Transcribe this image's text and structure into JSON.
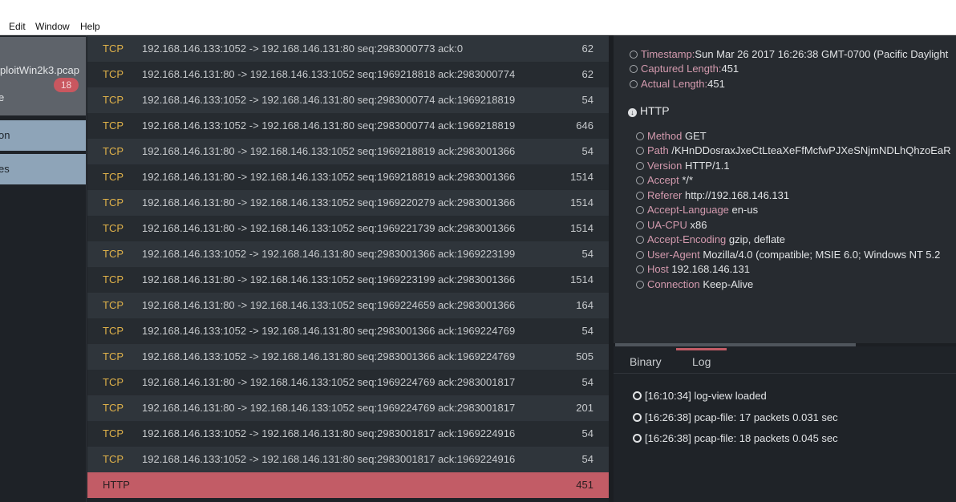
{
  "menu": {
    "items": [
      "Edit",
      "Window",
      "Help"
    ]
  },
  "sidebar": {
    "file_name": "ploitWin2k3.pcap",
    "file_sub": "e",
    "badge": "18",
    "buttons": [
      "on",
      "es"
    ]
  },
  "packets": [
    {
      "proto": "TCP",
      "summary": "192.168.146.133:1052 -> 192.168.146.131:80 seq:2983000773 ack:0",
      "length": "62"
    },
    {
      "proto": "TCP",
      "summary": "192.168.146.131:80 -> 192.168.146.133:1052 seq:1969218818 ack:2983000774",
      "length": "62"
    },
    {
      "proto": "TCP",
      "summary": "192.168.146.133:1052 -> 192.168.146.131:80 seq:2983000774 ack:1969218819",
      "length": "54"
    },
    {
      "proto": "TCP",
      "summary": "192.168.146.133:1052 -> 192.168.146.131:80 seq:2983000774 ack:1969218819",
      "length": "646"
    },
    {
      "proto": "TCP",
      "summary": "192.168.146.131:80 -> 192.168.146.133:1052 seq:1969218819 ack:2983001366",
      "length": "54"
    },
    {
      "proto": "TCP",
      "summary": "192.168.146.131:80 -> 192.168.146.133:1052 seq:1969218819 ack:2983001366",
      "length": "1514"
    },
    {
      "proto": "TCP",
      "summary": "192.168.146.131:80 -> 192.168.146.133:1052 seq:1969220279 ack:2983001366",
      "length": "1514"
    },
    {
      "proto": "TCP",
      "summary": "192.168.146.131:80 -> 192.168.146.133:1052 seq:1969221739 ack:2983001366",
      "length": "1514"
    },
    {
      "proto": "TCP",
      "summary": "192.168.146.133:1052 -> 192.168.146.131:80 seq:2983001366 ack:1969223199",
      "length": "54"
    },
    {
      "proto": "TCP",
      "summary": "192.168.146.131:80 -> 192.168.146.133:1052 seq:1969223199 ack:2983001366",
      "length": "1514"
    },
    {
      "proto": "TCP",
      "summary": "192.168.146.131:80 -> 192.168.146.133:1052 seq:1969224659 ack:2983001366",
      "length": "164"
    },
    {
      "proto": "TCP",
      "summary": "192.168.146.133:1052 -> 192.168.146.131:80 seq:2983001366 ack:1969224769",
      "length": "54"
    },
    {
      "proto": "TCP",
      "summary": "192.168.146.133:1052 -> 192.168.146.131:80 seq:2983001366 ack:1969224769",
      "length": "505"
    },
    {
      "proto": "TCP",
      "summary": "192.168.146.131:80 -> 192.168.146.133:1052 seq:1969224769 ack:2983001817",
      "length": "54"
    },
    {
      "proto": "TCP",
      "summary": "192.168.146.131:80 -> 192.168.146.133:1052 seq:1969224769 ack:2983001817",
      "length": "201"
    },
    {
      "proto": "TCP",
      "summary": "192.168.146.133:1052 -> 192.168.146.131:80 seq:2983001817 ack:1969224916",
      "length": "54"
    },
    {
      "proto": "TCP",
      "summary": "192.168.146.133:1052 -> 192.168.146.131:80 seq:2983001817 ack:1969224916",
      "length": "54"
    },
    {
      "proto": "HTTP",
      "summary": "",
      "length": "451",
      "selected": true
    }
  ],
  "frame": {
    "timestamp_key": "Timestamp:",
    "timestamp_val": "Sun Mar 26 2017 16:26:38 GMT-0700 (Pacific Daylight",
    "captured_key": "Captured Length:",
    "captured_val": "451",
    "actual_key": "Actual Length:",
    "actual_val": "451"
  },
  "http": {
    "label": "HTTP",
    "fields": [
      {
        "key": "Method",
        "val": "GET"
      },
      {
        "key": "Path",
        "val": "/KHnDDosraxJxeCtLteaXeFfMcfwPJXeSNjmNDLhQhzoEaR"
      },
      {
        "key": "Version",
        "val": "HTTP/1.1"
      },
      {
        "key": "Accept",
        "val": "*/*"
      },
      {
        "key": "Referer",
        "val": "http://192.168.146.131"
      },
      {
        "key": "Accept-Language",
        "val": "en-us"
      },
      {
        "key": "UA-CPU",
        "val": "x86"
      },
      {
        "key": "Accept-Encoding",
        "val": "gzip, deflate"
      },
      {
        "key": "User-Agent",
        "val": "Mozilla/4.0 (compatible; MSIE 6.0; Windows NT 5.2"
      },
      {
        "key": "Host",
        "val": "192.168.146.131"
      },
      {
        "key": "Connection",
        "val": "Keep-Alive"
      }
    ]
  },
  "tabs": {
    "binary": "Binary",
    "log": "Log",
    "active": "Log"
  },
  "log": [
    "[16:10:34] log-view loaded",
    "[16:26:38] pcap-file: 17 packets 0.031 sec",
    "[16:26:38] pcap-file: 18 packets 0.045 sec"
  ],
  "colors": {
    "accent": "#c25c66",
    "proto": "#e0b24a",
    "key": "#d39aae",
    "sidebar_button": "#8ea4b8"
  }
}
